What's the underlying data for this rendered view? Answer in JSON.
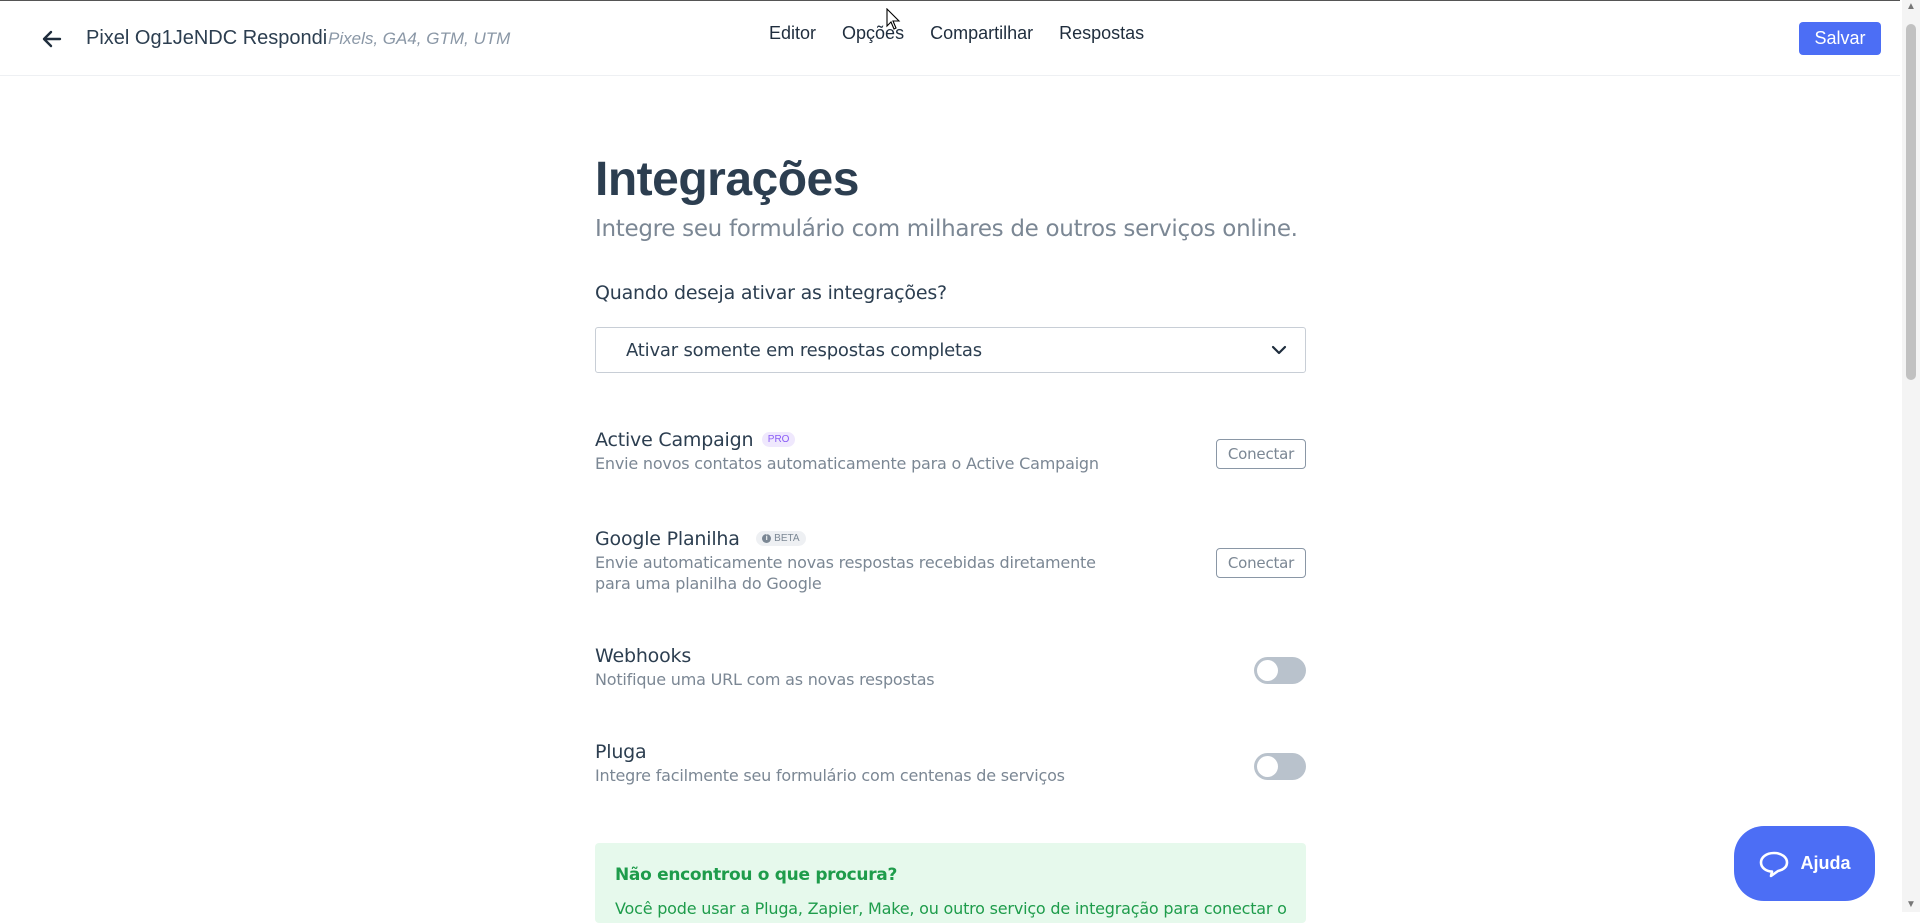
{
  "header": {
    "form_title": "Pixel Og1JeNDC Respondi",
    "form_tags": "Pixels, GA4, GTM, UTM",
    "nav": [
      "Editor",
      "Opções",
      "Compartilhar",
      "Respostas"
    ],
    "save_label": "Salvar"
  },
  "page": {
    "title": "Integrações",
    "subtitle": "Integre seu formulário com milhares de outros serviços online.",
    "question": "Quando deseja ativar as integrações?",
    "select_value": "Ativar somente em respostas completas"
  },
  "integrations": [
    {
      "name": "Active Campaign",
      "badge": "PRO",
      "description": "Envie novos contatos automaticamente para o Active Campaign",
      "action": "Conectar"
    },
    {
      "name": "Google Planilha",
      "badge": "BETA",
      "description_line1": "Envie automaticamente novas respostas recebidas diretamente",
      "description_line2": "para uma planilha do Google",
      "action": "Conectar"
    },
    {
      "name": "Webhooks",
      "description": "Notifique uma URL com as novas respostas",
      "enabled": false
    },
    {
      "name": "Pluga",
      "description": "Integre facilmente seu formulário com centenas de serviços",
      "enabled": false
    }
  ],
  "help_box": {
    "title": "Não encontrou o que procura?",
    "text": "Você pode usar a Pluga, Zapier, Make, ou outro serviço de integração para conectar o"
  },
  "help_widget": {
    "label": "Ajuda"
  },
  "colors": {
    "accent": "#4c6ef5",
    "pro_badge": "#8a5cf6",
    "success": "#1e9c4b"
  }
}
